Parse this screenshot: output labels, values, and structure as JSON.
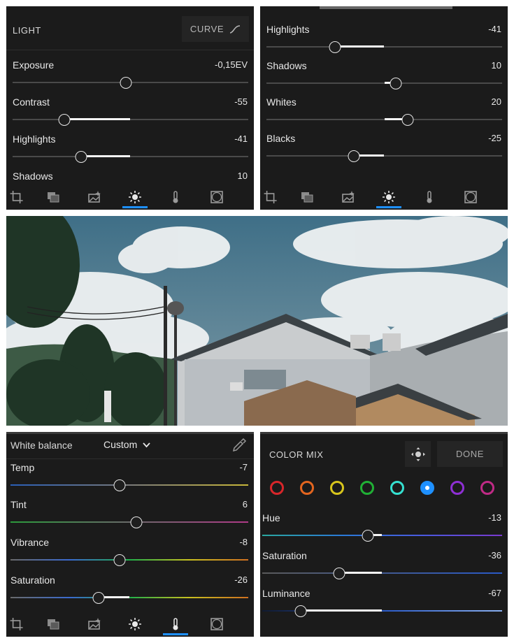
{
  "light_panel": {
    "title": "LIGHT",
    "curve_label": "CURVE",
    "sliders": [
      {
        "label": "Exposure",
        "value": "-0,15EV",
        "pos": 0.48
      },
      {
        "label": "Contrast",
        "value": "-55",
        "pos": 0.22
      },
      {
        "label": "Highlights",
        "value": "-41",
        "pos": 0.29
      },
      {
        "label": "Shadows",
        "value": "10",
        "pos": 0.55
      }
    ]
  },
  "tone_panel": {
    "sliders": [
      {
        "label": "Highlights",
        "value": "-41",
        "pos": 0.29
      },
      {
        "label": "Shadows",
        "value": "10",
        "pos": 0.55
      },
      {
        "label": "Whites",
        "value": "20",
        "pos": 0.6
      },
      {
        "label": "Blacks",
        "value": "-25",
        "pos": 0.37
      }
    ]
  },
  "wb_panel": {
    "title": "White balance",
    "preset": "Custom",
    "sliders": [
      {
        "label": "Temp",
        "value": "-7",
        "pos": 0.46
      },
      {
        "label": "Tint",
        "value": "6",
        "pos": 0.53
      },
      {
        "label": "Vibrance",
        "value": "-8",
        "pos": 0.46
      },
      {
        "label": "Saturation",
        "value": "-26",
        "pos": 0.37
      }
    ]
  },
  "mix_panel": {
    "title": "COLOR MIX",
    "done_label": "DONE",
    "swatches": [
      {
        "name": "red",
        "color": "#d8262a"
      },
      {
        "name": "orange",
        "color": "#e3651f"
      },
      {
        "name": "yellow",
        "color": "#d8c51c"
      },
      {
        "name": "green",
        "color": "#20b035"
      },
      {
        "name": "aqua",
        "color": "#35e0d0"
      },
      {
        "name": "blue",
        "color": "#1e90ff",
        "selected": true
      },
      {
        "name": "purple",
        "color": "#8e2fd4"
      },
      {
        "name": "magenta",
        "color": "#c02a86"
      }
    ],
    "sliders": [
      {
        "label": "Hue",
        "value": "-13",
        "pos": 0.44
      },
      {
        "label": "Saturation",
        "value": "-36",
        "pos": 0.32
      },
      {
        "label": "Luminance",
        "value": "-67",
        "pos": 0.16
      }
    ]
  },
  "tabs": [
    "crop-icon",
    "presets-icon",
    "effects-icon",
    "light-icon",
    "color-icon",
    "vignette-icon"
  ],
  "colors": {
    "accent": "#1e90ff",
    "panel_bg": "#1b1b1b",
    "track": "#4a4a4a",
    "fill": "#f4f4f4"
  }
}
